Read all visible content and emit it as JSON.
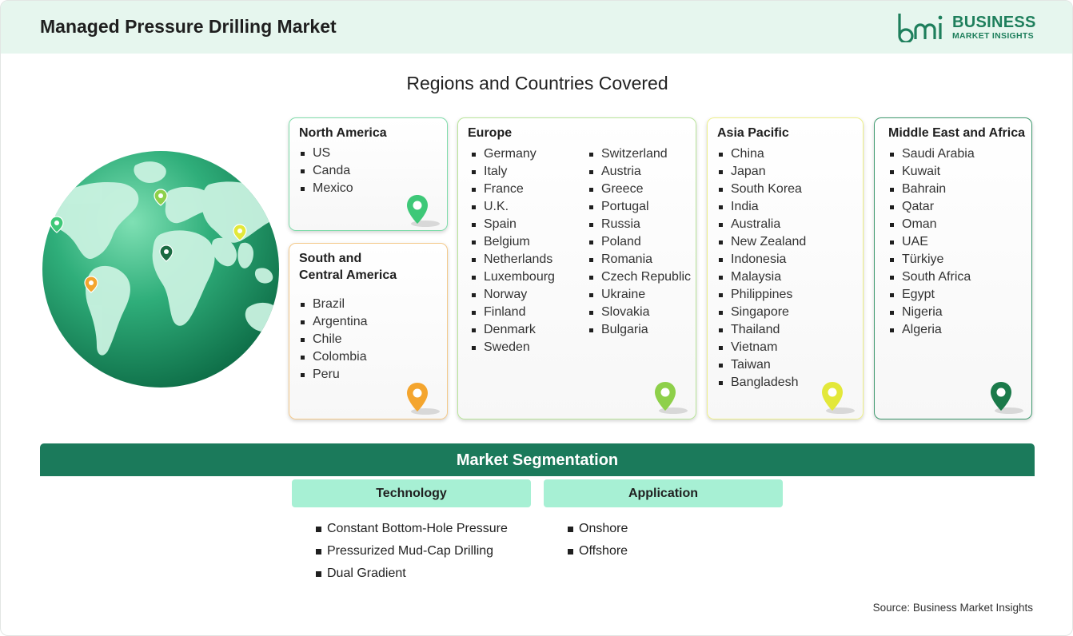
{
  "header": {
    "title": "Managed Pressure Drilling Market",
    "logo": {
      "line1": "BUSINESS",
      "line2": "MARKET INSIGHTS",
      "mark": "bmi"
    }
  },
  "regions_title": "Regions and Countries Covered",
  "regions": [
    {
      "name": "North America",
      "countries": [
        "US",
        "Canda",
        "Mexico"
      ],
      "color": "#3ec878"
    },
    {
      "name": "South and Central America",
      "name_line1": "South and",
      "name_line2": "Central America",
      "countries": [
        "Brazil",
        "Argentina",
        "Chile",
        "Colombia",
        "Peru"
      ],
      "color": "#f4a52e"
    },
    {
      "name": "Europe",
      "countries_col1": [
        "Germany",
        "Italy",
        "France",
        "U.K.",
        "Spain",
        "Belgium",
        "Netherlands",
        "Luxembourg",
        "Norway",
        "Finland",
        "Denmark",
        "Sweden"
      ],
      "countries_col2": [
        "Switzerland",
        "Austria",
        "Greece",
        "Portugal",
        "Russia",
        "Poland",
        "Romania",
        "Czech Republic",
        "Ukraine",
        "Slovakia",
        "Bulgaria"
      ],
      "color": "#8ed04a"
    },
    {
      "name": "Asia Pacific",
      "countries": [
        "China",
        "Japan",
        "South Korea",
        "India",
        "Australia",
        "New Zealand",
        "Indonesia",
        "Malaysia",
        "Philippines",
        "Singapore",
        "Thailand",
        "Vietnam",
        "Taiwan",
        "Bangladesh"
      ],
      "color": "#e3e83a"
    },
    {
      "name": "Middle East and Africa",
      "countries": [
        "Saudi Arabia",
        "Kuwait",
        "Bahrain",
        "Qatar",
        "Oman",
        "UAE",
        "Türkiye",
        "South Africa",
        "Egypt",
        "Nigeria",
        "Algeria"
      ],
      "color": "#1b7a4a"
    }
  ],
  "segmentation": {
    "title": "Market Segmentation",
    "groups": [
      {
        "name": "Technology",
        "items": [
          "Constant Bottom-Hole Pressure",
          "Pressurized Mud-Cap Drilling",
          "Dual Gradient"
        ]
      },
      {
        "name": "Application",
        "items": [
          "Onshore",
          "Offshore"
        ]
      }
    ]
  },
  "source": "Source: Business Market Insights",
  "colors": {
    "brand": "#1b7a5b",
    "header_bg": "#e6f6ee",
    "seg_head_bg": "#a7f0d4"
  }
}
